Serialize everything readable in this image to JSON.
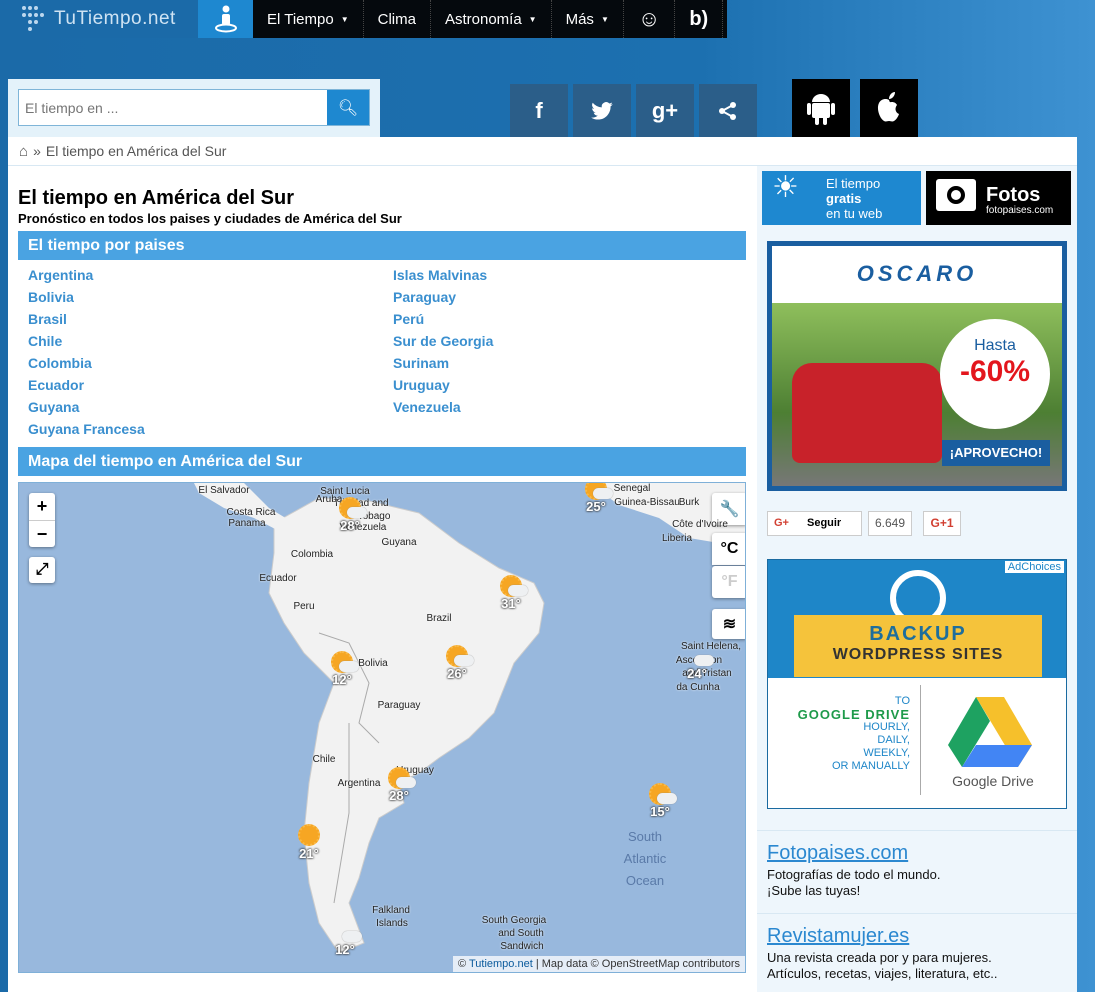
{
  "nav": {
    "logo": "TuTiempo.net",
    "items": [
      {
        "label": "El Tiempo",
        "dropdown": true
      },
      {
        "label": "Clima",
        "dropdown": false
      },
      {
        "label": "Astronomía",
        "dropdown": true
      },
      {
        "label": "Más",
        "dropdown": true
      }
    ],
    "icons": [
      "person-location-icon",
      "user-chat-icon",
      "blog-icon"
    ]
  },
  "search": {
    "placeholder": "El tiempo en ...",
    "icon": "search-icon"
  },
  "social": [
    {
      "name": "facebook-icon",
      "glyph": "f"
    },
    {
      "name": "twitter-icon",
      "glyph": "🐦"
    },
    {
      "name": "google-plus-icon",
      "glyph": "g+"
    },
    {
      "name": "share-icon",
      "glyph": "⋖"
    }
  ],
  "apps": [
    {
      "name": "android-icon",
      "glyph": "🤖"
    },
    {
      "name": "apple-icon",
      "glyph": ""
    }
  ],
  "breadcrumb": {
    "sep": "»",
    "current": "El tiempo en América del Sur"
  },
  "page": {
    "title": "El tiempo en América del Sur",
    "subtitle": "Pronóstico en todos los paises y ciudades de América del Sur",
    "countries_header": "El tiempo por paises",
    "map_header": "Mapa del tiempo en América del Sur"
  },
  "countries": {
    "col1": [
      "Argentina",
      "Bolivia",
      "Brasil",
      "Chile",
      "Colombia",
      "Ecuador",
      "Guyana",
      "Guyana Francesa"
    ],
    "col2": [
      "Islas Malvinas",
      "Paraguay",
      "Perú",
      "Sur de Georgia",
      "Surinam",
      "Uruguay",
      "Venezuela"
    ]
  },
  "map": {
    "zoom_in": "+",
    "zoom_out": "−",
    "fullscreen": "⤢",
    "wrench": "🔧",
    "celsius": "°C",
    "fahrenheit": "°F",
    "wind": "≋",
    "labels": [
      "El Salvador",
      "Costa Rica",
      "Panama",
      "Saint Lucia",
      "Trinidad and",
      "Tobago",
      "Aruba",
      "Venezuela",
      "Guyana",
      "Colombia",
      "Ecuador",
      "Peru",
      "Brazil",
      "Bolivia",
      "Paraguay",
      "Chile",
      "Argentina",
      "Uruguay",
      "Falkland",
      "Islands",
      "South Georgia",
      "and South",
      "Sandwich",
      "Senegal",
      "Guinea-Bissau",
      "Burk",
      "Côte d'Ivoire",
      "Liberia",
      "Saint Helena,",
      "Ascension",
      "and Tristan",
      "da Cunha",
      "South",
      "Atlantic",
      "Ocean"
    ],
    "temps": [
      "28°",
      "25°",
      "31°",
      "12°",
      "26°",
      "24°",
      "28°",
      "15°",
      "21°",
      "12°"
    ],
    "attribution_prefix": "©",
    "attribution_link": "Tutiempo.net",
    "attribution_rest": "| Map data © OpenStreetMap contributors"
  },
  "right": {
    "widget": {
      "line1": "El tiempo",
      "line2": "gratis",
      "line3": "en tu web"
    },
    "fotos": {
      "title": "Fotos",
      "sub": "fotopaises.com"
    },
    "ad1": {
      "brand": "OSCARO",
      "hasta": "Hasta",
      "discount": "-60%",
      "cta": "¡APROVECHO!"
    },
    "gplus": {
      "follow": "Seguir",
      "count": "6.649",
      "plus_one": "G+1",
      "icon": "G+"
    },
    "ad2": {
      "adchoices": "AdChoices",
      "line1": "BACKUP",
      "line2": "WORDPRESS SITES",
      "to": "TO",
      "gd": "GOOGLE DRIVE",
      "freq": [
        "HOURLY,",
        "DAILY,",
        "WEEKLY,",
        "OR MANUALLY"
      ],
      "logo_text": "Google Drive"
    },
    "links": [
      {
        "title": "Fotopaises.com",
        "lines": [
          "Fotografías de todo el mundo.",
          "¡Sube las tuyas!"
        ]
      },
      {
        "title": "Revistamujer.es",
        "lines": [
          "Una revista creada por y para mujeres.",
          "Artículos, recetas, viajes, literatura, etc.."
        ]
      }
    ]
  },
  "colors": {
    "accent": "#1e88d0",
    "section": "#4aa3e2",
    "link": "#3a8fcf",
    "ocean": "#98b8dd",
    "land": "#f2f2f2"
  }
}
